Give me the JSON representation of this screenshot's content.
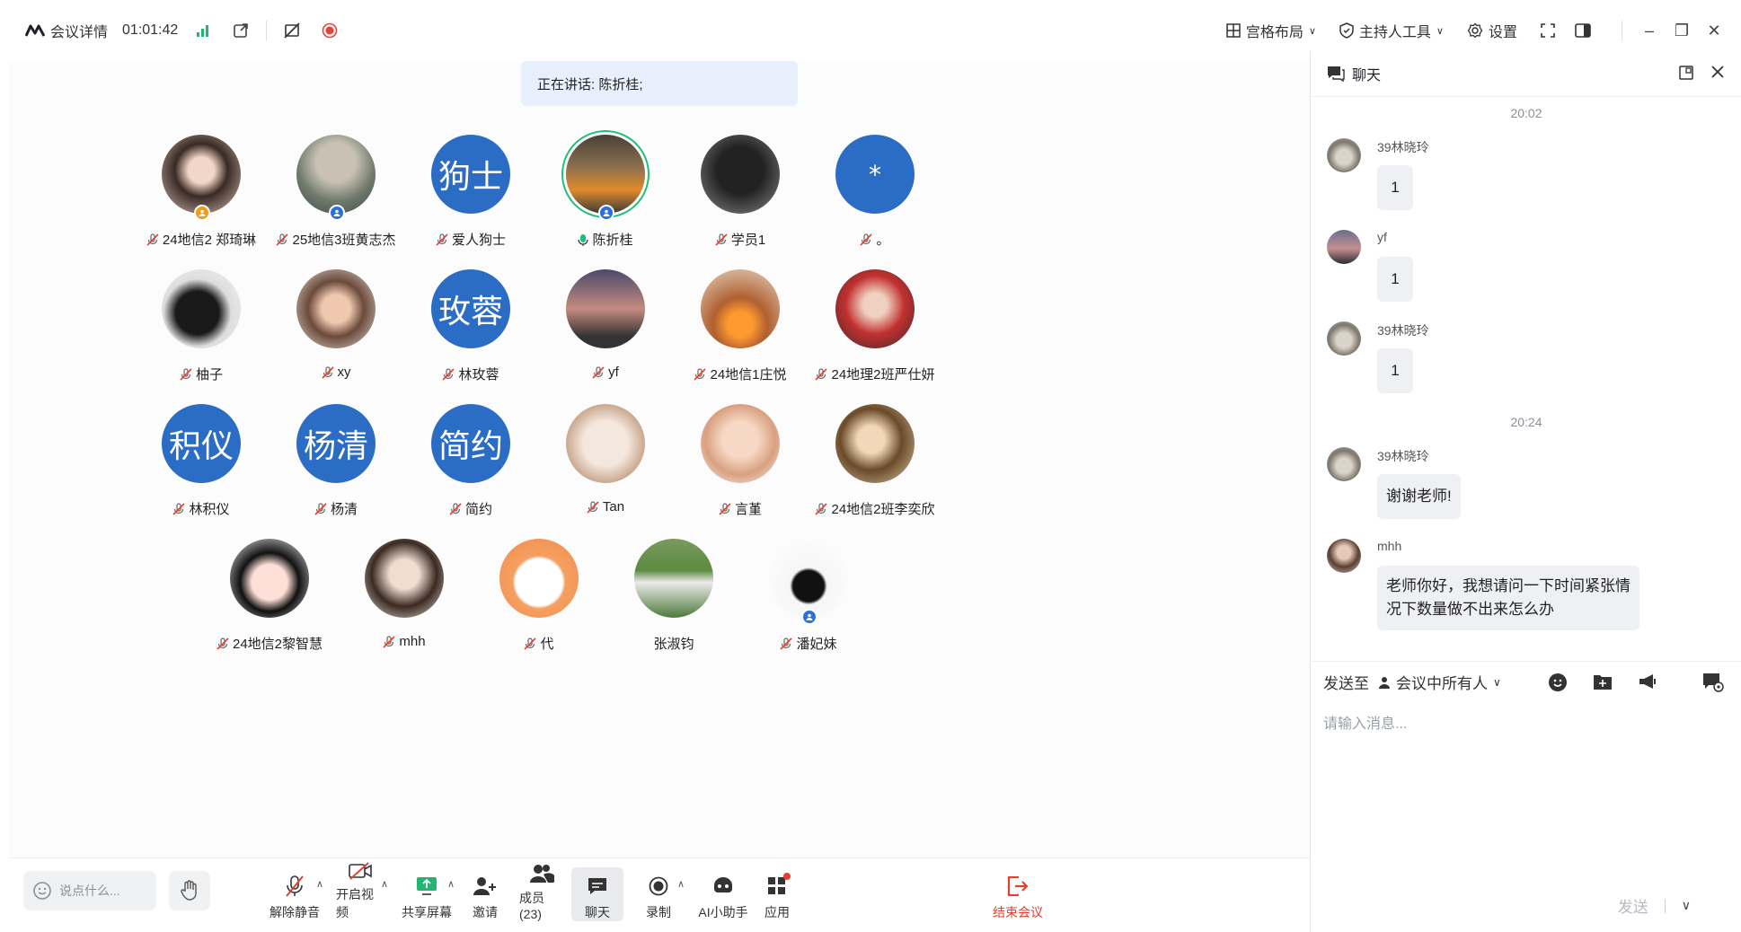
{
  "topbar": {
    "meeting_details": "会议详情",
    "timer": "01:01:42",
    "layout": "宫格布局",
    "host_tools": "主持人工具",
    "settings": "设置"
  },
  "stage": {
    "speaking": "正在讲话: 陈折桂;",
    "participants": [
      {
        "name": "24地信2 郑琦琳",
        "avatar": "photo",
        "mic": "muted",
        "badge": "orange"
      },
      {
        "name": "25地信3班黄志杰",
        "avatar": "photo",
        "mic": "muted",
        "badge": "blue"
      },
      {
        "name": "爱人狗士",
        "avatar_text": "狗士",
        "mic": "muted"
      },
      {
        "name": "陈折桂",
        "avatar": "photo",
        "mic": "speaking",
        "badge": "blue",
        "active": true
      },
      {
        "name": "学员1",
        "avatar": "photo",
        "mic": "muted"
      },
      {
        "name": "。",
        "avatar_text": "*",
        "mic": "muted"
      },
      {
        "name": "柚子",
        "avatar": "photo",
        "mic": "muted"
      },
      {
        "name": "xy",
        "avatar": "photo",
        "mic": "muted"
      },
      {
        "name": "林玫蓉",
        "avatar_text": "玫蓉",
        "mic": "muted"
      },
      {
        "name": "yf",
        "avatar": "photo",
        "mic": "muted"
      },
      {
        "name": "24地信1庄悦",
        "avatar": "photo",
        "mic": "muted"
      },
      {
        "name": "24地理2班严仕妍",
        "avatar": "photo",
        "mic": "muted"
      },
      {
        "name": "林积仪",
        "avatar_text": "积仪",
        "mic": "muted"
      },
      {
        "name": "杨清",
        "avatar_text": "杨清",
        "mic": "muted"
      },
      {
        "name": "简约",
        "avatar_text": "简约",
        "mic": "muted"
      },
      {
        "name": "Tan",
        "avatar": "photo",
        "mic": "muted"
      },
      {
        "name": "言堇",
        "avatar": "photo",
        "mic": "muted"
      },
      {
        "name": "24地信2班李奕欣",
        "avatar": "photo",
        "mic": "muted"
      },
      {
        "name": "24地信2黎智慧",
        "avatar": "photo",
        "mic": "muted"
      },
      {
        "name": "mhh",
        "avatar": "photo",
        "mic": "muted"
      },
      {
        "name": "代",
        "avatar": "photo",
        "mic": "muted"
      },
      {
        "name": "张淑钧",
        "avatar": "photo",
        "mic": "none"
      },
      {
        "name": "潘妃妹",
        "avatar": "photo",
        "mic": "muted",
        "badge": "blue"
      }
    ]
  },
  "toolbar": {
    "say_placeholder": "说点什么...",
    "unmute": "解除静音",
    "video": "开启视频",
    "share": "共享屏幕",
    "invite": "邀请",
    "members": "成员(23)",
    "chat": "聊天",
    "record": "录制",
    "ai": "AI小助手",
    "apps": "应用",
    "end": "结束会议"
  },
  "chat": {
    "title": "聊天",
    "time1": "20:02",
    "time2": "20:24",
    "messages": [
      {
        "sender": "39林晓玲",
        "text": "1"
      },
      {
        "sender": "yf",
        "text": "1"
      },
      {
        "sender": "39林晓玲",
        "text": "1"
      },
      {
        "sender": "39林晓玲",
        "text": "谢谢老师!"
      },
      {
        "sender": "mhh",
        "line1": "老师你好，我想请问一下时间紧张情",
        "line2": "况下数量做不出来怎么办"
      }
    ],
    "send_to_label": "发送至",
    "send_to_target": "会议中所有人",
    "input_placeholder": "请输入消息...",
    "send": "发送"
  },
  "colors": {
    "accent": "#2b6cc4",
    "speaking_ring": "#1fbf7a",
    "end_red": "#e5402f",
    "record_red": "#e8433a"
  }
}
